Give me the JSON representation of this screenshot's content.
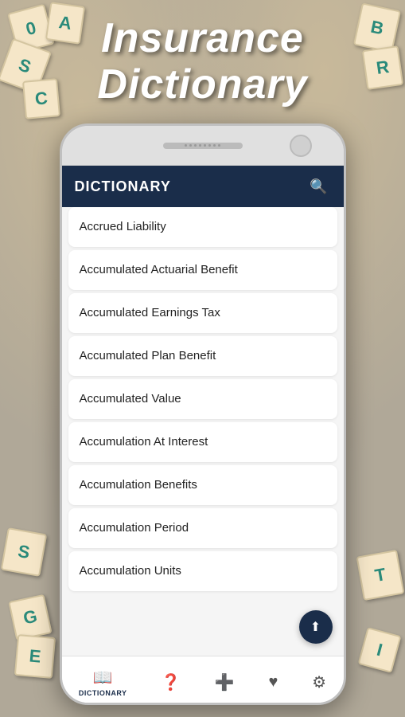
{
  "app": {
    "title_line1": "Insurance",
    "title_line2": "Dictionary"
  },
  "header": {
    "title": "DICTIONARY",
    "search_icon": "🔍"
  },
  "list": {
    "items": [
      {
        "label": "Accrued Liability"
      },
      {
        "label": "Accumulated Actuarial Benefit"
      },
      {
        "label": "Accumulated Earnings Tax"
      },
      {
        "label": "Accumulated Plan Benefit"
      },
      {
        "label": "Accumulated Value"
      },
      {
        "label": "Accumulation At Interest"
      },
      {
        "label": "Accumulation Benefits"
      },
      {
        "label": "Accumulation Period"
      },
      {
        "label": "Accumulation Units"
      }
    ]
  },
  "tiles": [
    {
      "letter": "0"
    },
    {
      "letter": "A"
    },
    {
      "letter": "B"
    },
    {
      "letter": "R"
    },
    {
      "letter": "S"
    },
    {
      "letter": "C"
    },
    {
      "letter": "S"
    },
    {
      "letter": "G"
    },
    {
      "letter": "E"
    },
    {
      "letter": "T"
    },
    {
      "letter": "I"
    }
  ],
  "scroll_top": {
    "icon": "⬆"
  },
  "bottom_nav": [
    {
      "icon": "📖",
      "label": "DICTIONARY",
      "active": true
    },
    {
      "icon": "❓",
      "label": "",
      "active": false
    },
    {
      "icon": "➕",
      "label": "",
      "active": false
    },
    {
      "icon": "♥",
      "label": "",
      "active": false
    },
    {
      "icon": "⚙",
      "label": "",
      "active": false
    }
  ]
}
